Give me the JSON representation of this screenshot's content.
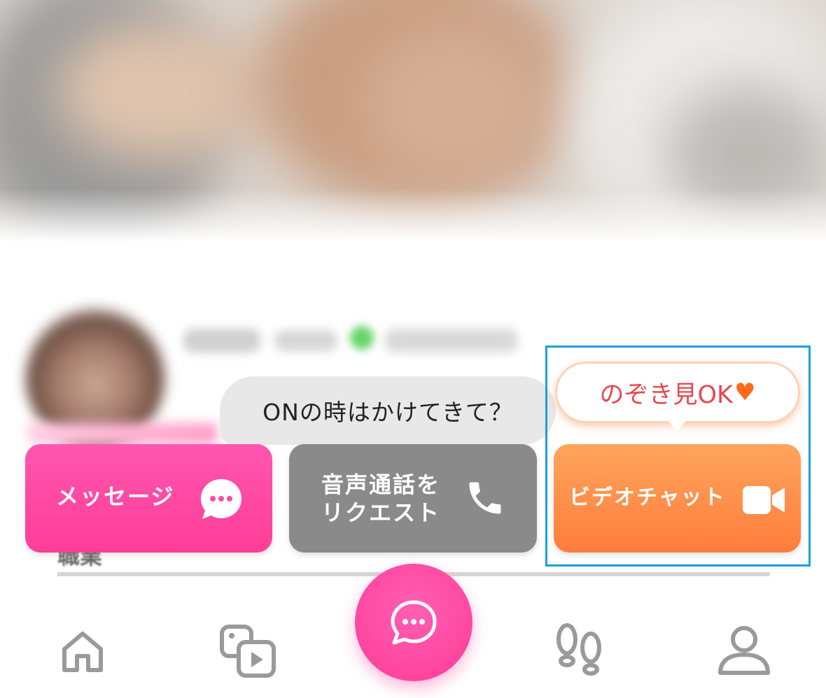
{
  "page_fragment": "職業",
  "chat_prompt": {
    "text": "ONの時はかけてきて？"
  },
  "peek_badge": {
    "text": "のぞき見OK",
    "icon": "heart-icon"
  },
  "actions": [
    {
      "label": "メッセージ",
      "icon": "chat-bubble-icon",
      "color": "#ff4aa3"
    },
    {
      "label": "音声通話を\nリクエスト",
      "icon": "phone-icon",
      "color": "#8a8a8a"
    },
    {
      "label": "ビデオチャット",
      "icon": "video-camera-icon",
      "color": "#ff8c45"
    }
  ],
  "bottom_nav": {
    "items": [
      {
        "icon": "home-icon"
      },
      {
        "icon": "media-gallery-icon"
      },
      {
        "icon": "chat-fab-icon"
      },
      {
        "icon": "footprints-icon"
      },
      {
        "icon": "profile-icon"
      }
    ]
  },
  "highlight_color": "#1a9fe0"
}
